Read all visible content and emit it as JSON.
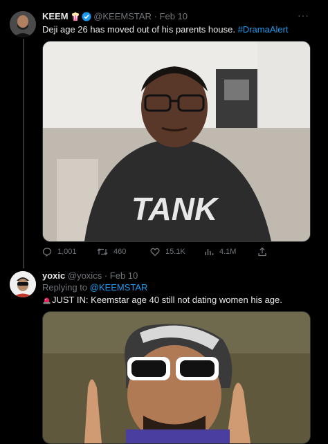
{
  "tweet1": {
    "display_name": "KEEM",
    "handle": "@KEEMSTAR",
    "separator": "·",
    "date": "Feb 10",
    "text_main": "Deji age 26 has moved out of his parents house. ",
    "hashtag": "#DramaAlert",
    "stats": {
      "replies": "1,001",
      "retweets": "460",
      "likes": "15.1K",
      "views": "4.1M"
    }
  },
  "tweet2": {
    "display_name": "yoxic",
    "handle": "@yoxics",
    "separator": "·",
    "date": "Feb 10",
    "replying_prefix": "Replying to ",
    "replying_handle": "@KEEMSTAR",
    "text": "JUST IN: Keemstar age 40 still not dating women his age."
  },
  "icons": [
    "reply-icon",
    "retweet-icon",
    "like-icon",
    "views-icon",
    "share-icon",
    "verified-badge-icon",
    "popcorn-emoji-icon",
    "siren-emoji-icon",
    "more-icon"
  ],
  "colors": {
    "background": "#000000",
    "text": "#e7e9ea",
    "muted": "#71767b",
    "link": "#1d9bf0",
    "verified": "#1d9bf0"
  }
}
